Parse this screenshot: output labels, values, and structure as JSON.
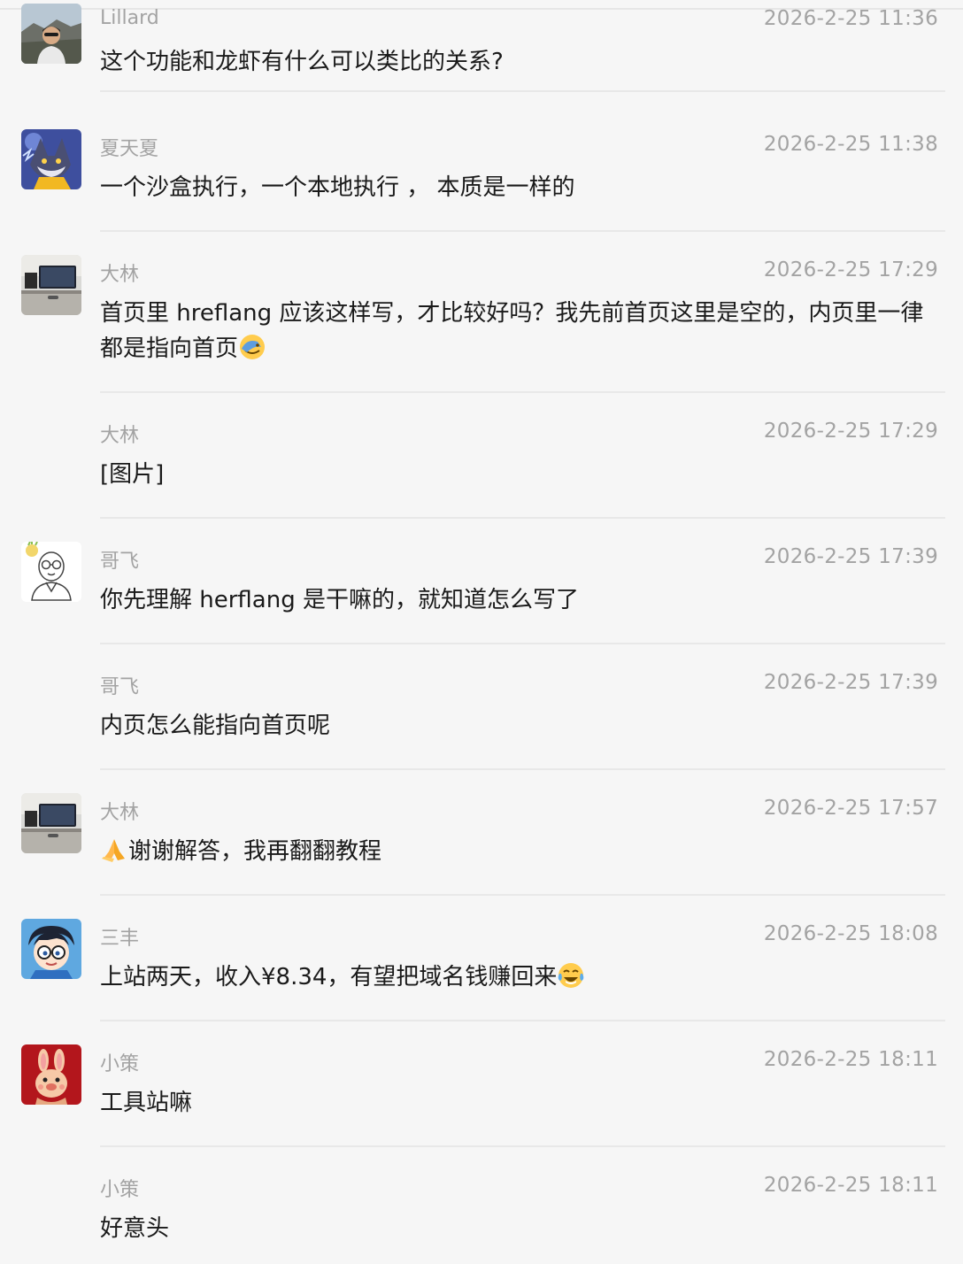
{
  "messages": [
    {
      "name": "Lillard",
      "time": "2026-2-25 11:36",
      "avatar": "person-mountain-photo",
      "text": "这个功能和龙虾有什么可以类比的关系?"
    },
    {
      "name": "夏天夏",
      "time": "2026-2-25 11:38",
      "avatar": "anime-fox-avatar",
      "text": "一个沙盒执行，一个本地执行 ， 本质是一样的"
    },
    {
      "name": "大林",
      "time": "2026-2-25 17:29",
      "avatar": "desk-monitor-photo",
      "text": "首页里  hreflang 应该这样写，才比较好吗？我先前首页这里是空的，内页里一律都是指向首页",
      "emoji_after": "facepalm-emoji"
    },
    {
      "name": "大林",
      "time": "2026-2-25 17:29",
      "avatar": "",
      "text": "[图片]"
    },
    {
      "name": "哥飞",
      "time": "2026-2-25 17:39",
      "avatar": "cartoon-glasses-man",
      "text": "你先理解 herflang 是干嘛的，就知道怎么写了"
    },
    {
      "name": "哥飞",
      "time": "2026-2-25 17:39",
      "avatar": "",
      "text": "内页怎么能指向首页呢"
    },
    {
      "name": "大林",
      "time": "2026-2-25 17:57",
      "avatar": "desk-monitor-photo",
      "text": "谢谢解答，我再翻翻教程",
      "emoji_before": "folded-hands-emoji"
    },
    {
      "name": "三丰",
      "time": "2026-2-25 18:08",
      "avatar": "anime-glasses-boy",
      "text": "上站两天，收入¥8.34，有望把域名钱赚回来",
      "emoji_after": "tears-of-joy-emoji"
    },
    {
      "name": "小策",
      "time": "2026-2-25 18:11",
      "avatar": "red-rabbit-avatar",
      "text": "工具站嘛"
    },
    {
      "name": "小策",
      "time": "2026-2-25 18:11",
      "avatar": "",
      "text": "好意头"
    }
  ]
}
